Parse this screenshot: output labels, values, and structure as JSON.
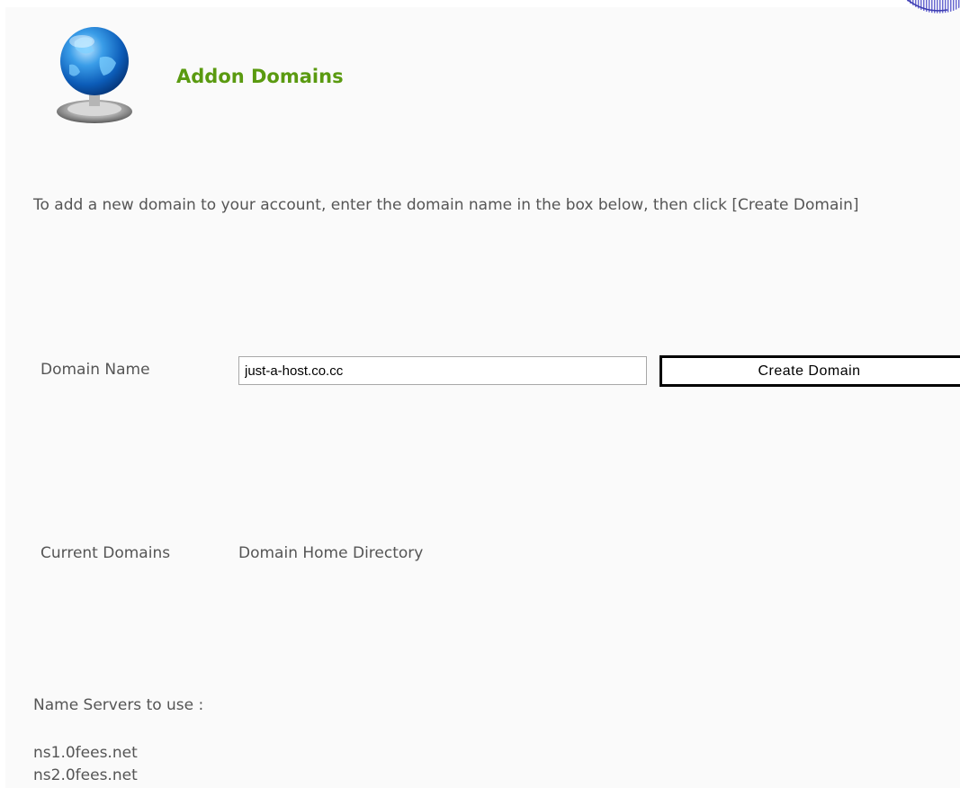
{
  "header": {
    "title": "Addon Domains",
    "icon": "globe-icon"
  },
  "instructions": "To add a new domain to your account, enter the domain name in the box below, then click [Create Domain]",
  "form": {
    "domain_label": "Domain Name",
    "domain_value": "just-a-host.co.cc",
    "create_button_label": "Create Domain"
  },
  "domains_table": {
    "columns": [
      "Current Domains",
      "Domain Home Directory"
    ]
  },
  "name_servers": {
    "label": "Name Servers to use :",
    "servers": [
      "ns1.0fees.net",
      "ns2.0fees.net"
    ]
  },
  "colors": {
    "title": "#5a9a10",
    "text": "#555555",
    "background": "#fafafa"
  }
}
